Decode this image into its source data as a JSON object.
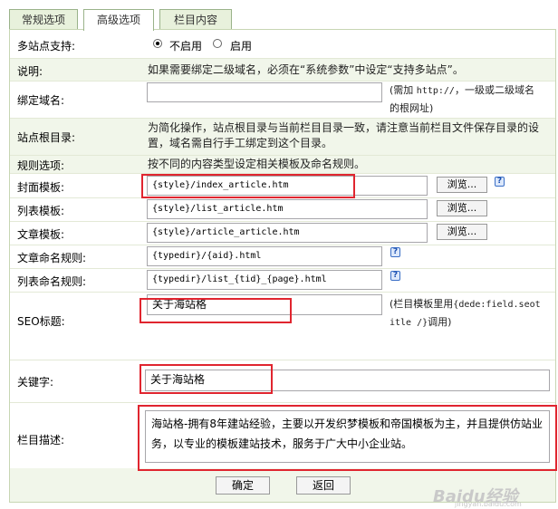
{
  "tabs": [
    "常规选项",
    "高级选项",
    "栏目内容"
  ],
  "multisite": {
    "label": "多站点支持:",
    "option_off": "不启用",
    "option_on": "启用",
    "selected": "不启用"
  },
  "note": {
    "label": "说明:",
    "text": "如果需要绑定二级域名，必须在“系统参数”中设定“支持多站点”。"
  },
  "domain": {
    "label": "绑定域名:",
    "value": "",
    "hint_prefix": "(需加 ",
    "hint_mono": "http://",
    "hint_line1_suffix": "，一级或二级域名",
    "hint_line2": "的根网址)"
  },
  "siteroot": {
    "label": "站点根目录:",
    "line1": "为简化操作，站点根目录与当前栏目目录一致，请注意当前栏目文件保存目录的设",
    "line2": "置，域名需自行手工绑定到这个目录。"
  },
  "rules": {
    "label": "规则选项:",
    "text": "按不同的内容类型设定相关模板及命名规则。"
  },
  "cover_tpl": {
    "label": "封面模板:",
    "value": "{style}/index_article.htm",
    "button": "浏览..."
  },
  "list_tpl": {
    "label": "列表模板:",
    "value": "{style}/list_article.htm",
    "button": "浏览..."
  },
  "article_tpl": {
    "label": "文章模板:",
    "value": "{style}/article_article.htm",
    "button": "浏览..."
  },
  "article_rule": {
    "label": "文章命名规则:",
    "value": "{typedir}/{aid}.html"
  },
  "list_rule": {
    "label": "列表命名规则:",
    "value": "{typedir}/list_{tid}_{page}.html"
  },
  "seo": {
    "label": "SEO标题:",
    "value": "关于海站格",
    "hint_prefix": "(栏目模板里用",
    "hint_mono1": "{dede:field.seot",
    "hint_mono2": "itle /}",
    "hint_suffix": "调用)"
  },
  "keywords": {
    "label": "关键字:",
    "value": "关于海站格"
  },
  "description": {
    "label": "栏目描述:",
    "value": "海站格-拥有8年建站经验，主要以开发织梦模板和帝国模板为主，并且提供仿站业务，以专业的模板建站技术，服务于广大中小企业站。"
  },
  "buttons": {
    "ok": "确定",
    "back": "返回"
  },
  "help_icon_glyph": "?",
  "watermark": {
    "brand": "Baidu经验",
    "url": "jingyan.baidu.com"
  },
  "colors": {
    "highlight": "#e0252f",
    "tab_bg": "#e8f1dc",
    "row_shade": "#f1f6ea",
    "border": "#c7d6b3"
  }
}
